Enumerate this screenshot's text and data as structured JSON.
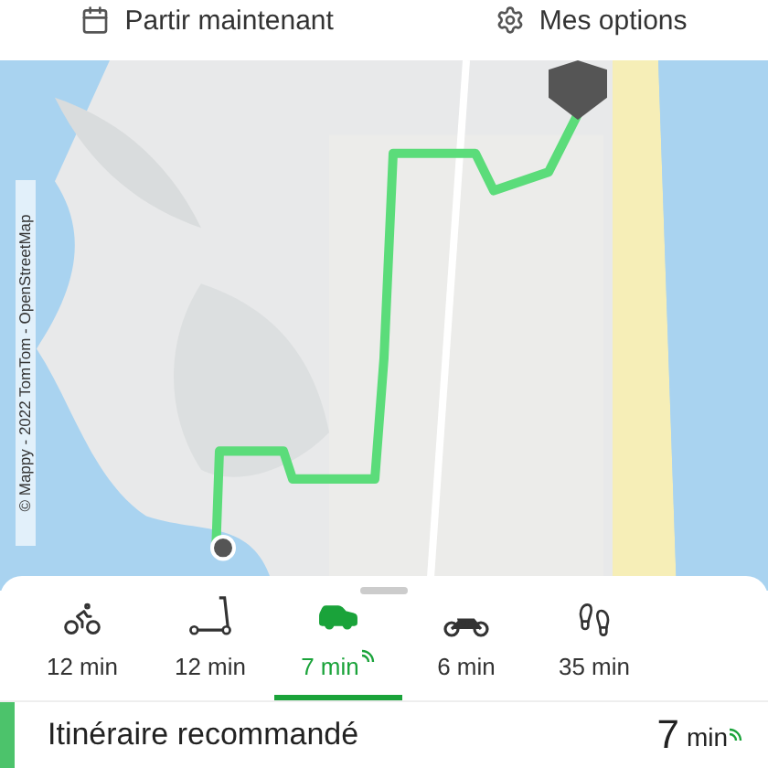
{
  "header": {
    "buttons": [
      {
        "kind": "calendar",
        "label": "Partir maintenant"
      },
      {
        "kind": "settings",
        "label": "Mes options"
      }
    ]
  },
  "map": {
    "attribution": "© Mappy - 2022 TomTom - OpenStreetMap"
  },
  "modes": [
    {
      "kind": "bike",
      "label": "12 min",
      "selected": false,
      "live": false
    },
    {
      "kind": "scooter",
      "label": "12 min",
      "selected": false,
      "live": false
    },
    {
      "kind": "car",
      "label": "7 min",
      "selected": true,
      "live": true
    },
    {
      "kind": "moto",
      "label": "6 min",
      "selected": false,
      "live": false
    },
    {
      "kind": "walk",
      "label": "35 min",
      "selected": false,
      "live": false
    }
  ],
  "route": {
    "title": "Itinéraire recommandé",
    "duration": "7",
    "unit": "min",
    "live": true
  }
}
